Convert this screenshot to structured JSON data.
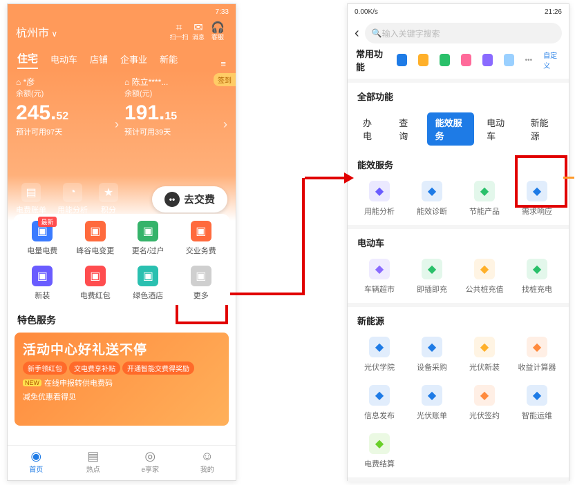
{
  "p1": {
    "status": "7:33",
    "city": "杭州市",
    "topicons": [
      {
        "l": "扫一扫"
      },
      {
        "l": "消息"
      },
      {
        "l": "客服"
      }
    ],
    "tabs": [
      "住宅",
      "电动车",
      "店铺",
      "企事业",
      "新能"
    ],
    "cards": [
      {
        "name": "彦",
        "sub": "余额(元)",
        "amt_main": "245.",
        "amt_dec": "52",
        "days": "预计可用97天"
      },
      {
        "name": "陈立****...",
        "sub": "余额(元)",
        "amt_main": "191.",
        "amt_dec": "15",
        "days": "预计可用39天"
      }
    ],
    "signin": "签到",
    "actions": [
      {
        "l": "电费账单"
      },
      {
        "l": "用能分析"
      },
      {
        "l": "积分"
      }
    ],
    "pay": "去交费",
    "grid": [
      {
        "l": "电量电费",
        "c": "#3a7bff",
        "badge": "最新"
      },
      {
        "l": "峰谷电变更",
        "c": "#ff6a3d"
      },
      {
        "l": "更名/过户",
        "c": "#35b36a"
      },
      {
        "l": "交业务费",
        "c": "#ff6a3d"
      },
      {
        "l": "新装",
        "c": "#6a5cff"
      },
      {
        "l": "电费红包",
        "c": "#ff4d4f"
      },
      {
        "l": "绿色酒店",
        "c": "#2ac0b0"
      },
      {
        "l": "更多",
        "c": "#cfcfcf"
      }
    ],
    "sec": "特色服务",
    "banner": {
      "big": "活动中心好礼送不停",
      "pills": [
        "新手领红包",
        "交电费享补贴",
        "开通智能交费得奖励"
      ],
      "line1": "在线申报转供电费码",
      "line2": "减免优惠看得见",
      "new": "NEW"
    },
    "nav": [
      {
        "l": "首页"
      },
      {
        "l": "热点"
      },
      {
        "l": "e享家"
      },
      {
        "l": "我的"
      }
    ]
  },
  "p2": {
    "status_l": "0.00K/s",
    "status_r": "21:26",
    "search_ph": "输入关键字搜索",
    "fav": "常用功能",
    "cust": "自定义",
    "all": "全部功能",
    "tabs": [
      "办电",
      "查询",
      "能效服务",
      "电动车",
      "新能源"
    ],
    "sections": [
      {
        "title": "能效服务",
        "items": [
          {
            "l": "用能分析",
            "c": "#6a5cff"
          },
          {
            "l": "能效诊断",
            "c": "#1e7be6"
          },
          {
            "l": "节能产品",
            "c": "#2ac06a"
          },
          {
            "l": "需求响应",
            "c": "#1e7be6"
          }
        ]
      },
      {
        "title": "电动车",
        "items": [
          {
            "l": "车辆超市",
            "c": "#8a6aff"
          },
          {
            "l": "即插即充",
            "c": "#2ac06a"
          },
          {
            "l": "公共桩充值",
            "c": "#ffb02a"
          },
          {
            "l": "找桩充电",
            "c": "#2ac06a"
          }
        ]
      },
      {
        "title": "新能源",
        "items": [
          {
            "l": "光伏学院",
            "c": "#1e7be6"
          },
          {
            "l": "设备采购",
            "c": "#1e7be6"
          },
          {
            "l": "光伏新装",
            "c": "#ffb02a"
          },
          {
            "l": "收益计算器",
            "c": "#ff8a3d"
          },
          {
            "l": "信息发布",
            "c": "#1e7be6"
          },
          {
            "l": "光伏账单",
            "c": "#1e7be6"
          },
          {
            "l": "光伏签约",
            "c": "#ff8a3d"
          },
          {
            "l": "智能运维",
            "c": "#1e7be6"
          },
          {
            "l": "电费结算",
            "c": "#6ad02a"
          }
        ]
      }
    ]
  }
}
